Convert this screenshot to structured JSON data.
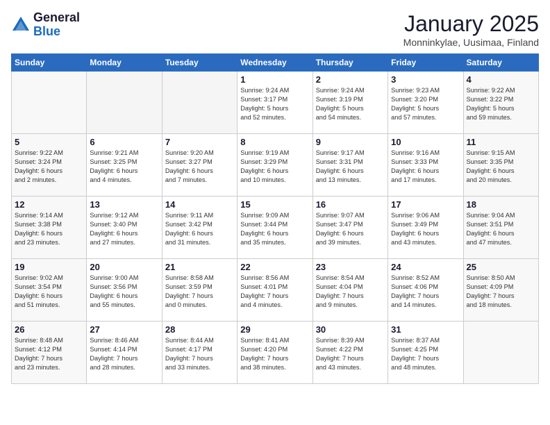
{
  "header": {
    "logo_general": "General",
    "logo_blue": "Blue",
    "month_year": "January 2025",
    "location": "Monninkylae, Uusimaa, Finland"
  },
  "days_of_week": [
    "Sunday",
    "Monday",
    "Tuesday",
    "Wednesday",
    "Thursday",
    "Friday",
    "Saturday"
  ],
  "weeks": [
    [
      {
        "day": "",
        "info": ""
      },
      {
        "day": "",
        "info": ""
      },
      {
        "day": "",
        "info": ""
      },
      {
        "day": "1",
        "info": "Sunrise: 9:24 AM\nSunset: 3:17 PM\nDaylight: 5 hours\nand 52 minutes."
      },
      {
        "day": "2",
        "info": "Sunrise: 9:24 AM\nSunset: 3:19 PM\nDaylight: 5 hours\nand 54 minutes."
      },
      {
        "day": "3",
        "info": "Sunrise: 9:23 AM\nSunset: 3:20 PM\nDaylight: 5 hours\nand 57 minutes."
      },
      {
        "day": "4",
        "info": "Sunrise: 9:22 AM\nSunset: 3:22 PM\nDaylight: 5 hours\nand 59 minutes."
      }
    ],
    [
      {
        "day": "5",
        "info": "Sunrise: 9:22 AM\nSunset: 3:24 PM\nDaylight: 6 hours\nand 2 minutes."
      },
      {
        "day": "6",
        "info": "Sunrise: 9:21 AM\nSunset: 3:25 PM\nDaylight: 6 hours\nand 4 minutes."
      },
      {
        "day": "7",
        "info": "Sunrise: 9:20 AM\nSunset: 3:27 PM\nDaylight: 6 hours\nand 7 minutes."
      },
      {
        "day": "8",
        "info": "Sunrise: 9:19 AM\nSunset: 3:29 PM\nDaylight: 6 hours\nand 10 minutes."
      },
      {
        "day": "9",
        "info": "Sunrise: 9:17 AM\nSunset: 3:31 PM\nDaylight: 6 hours\nand 13 minutes."
      },
      {
        "day": "10",
        "info": "Sunrise: 9:16 AM\nSunset: 3:33 PM\nDaylight: 6 hours\nand 17 minutes."
      },
      {
        "day": "11",
        "info": "Sunrise: 9:15 AM\nSunset: 3:35 PM\nDaylight: 6 hours\nand 20 minutes."
      }
    ],
    [
      {
        "day": "12",
        "info": "Sunrise: 9:14 AM\nSunset: 3:38 PM\nDaylight: 6 hours\nand 23 minutes."
      },
      {
        "day": "13",
        "info": "Sunrise: 9:12 AM\nSunset: 3:40 PM\nDaylight: 6 hours\nand 27 minutes."
      },
      {
        "day": "14",
        "info": "Sunrise: 9:11 AM\nSunset: 3:42 PM\nDaylight: 6 hours\nand 31 minutes."
      },
      {
        "day": "15",
        "info": "Sunrise: 9:09 AM\nSunset: 3:44 PM\nDaylight: 6 hours\nand 35 minutes."
      },
      {
        "day": "16",
        "info": "Sunrise: 9:07 AM\nSunset: 3:47 PM\nDaylight: 6 hours\nand 39 minutes."
      },
      {
        "day": "17",
        "info": "Sunrise: 9:06 AM\nSunset: 3:49 PM\nDaylight: 6 hours\nand 43 minutes."
      },
      {
        "day": "18",
        "info": "Sunrise: 9:04 AM\nSunset: 3:51 PM\nDaylight: 6 hours\nand 47 minutes."
      }
    ],
    [
      {
        "day": "19",
        "info": "Sunrise: 9:02 AM\nSunset: 3:54 PM\nDaylight: 6 hours\nand 51 minutes."
      },
      {
        "day": "20",
        "info": "Sunrise: 9:00 AM\nSunset: 3:56 PM\nDaylight: 6 hours\nand 55 minutes."
      },
      {
        "day": "21",
        "info": "Sunrise: 8:58 AM\nSunset: 3:59 PM\nDaylight: 7 hours\nand 0 minutes."
      },
      {
        "day": "22",
        "info": "Sunrise: 8:56 AM\nSunset: 4:01 PM\nDaylight: 7 hours\nand 4 minutes."
      },
      {
        "day": "23",
        "info": "Sunrise: 8:54 AM\nSunset: 4:04 PM\nDaylight: 7 hours\nand 9 minutes."
      },
      {
        "day": "24",
        "info": "Sunrise: 8:52 AM\nSunset: 4:06 PM\nDaylight: 7 hours\nand 14 minutes."
      },
      {
        "day": "25",
        "info": "Sunrise: 8:50 AM\nSunset: 4:09 PM\nDaylight: 7 hours\nand 18 minutes."
      }
    ],
    [
      {
        "day": "26",
        "info": "Sunrise: 8:48 AM\nSunset: 4:12 PM\nDaylight: 7 hours\nand 23 minutes."
      },
      {
        "day": "27",
        "info": "Sunrise: 8:46 AM\nSunset: 4:14 PM\nDaylight: 7 hours\nand 28 minutes."
      },
      {
        "day": "28",
        "info": "Sunrise: 8:44 AM\nSunset: 4:17 PM\nDaylight: 7 hours\nand 33 minutes."
      },
      {
        "day": "29",
        "info": "Sunrise: 8:41 AM\nSunset: 4:20 PM\nDaylight: 7 hours\nand 38 minutes."
      },
      {
        "day": "30",
        "info": "Sunrise: 8:39 AM\nSunset: 4:22 PM\nDaylight: 7 hours\nand 43 minutes."
      },
      {
        "day": "31",
        "info": "Sunrise: 8:37 AM\nSunset: 4:25 PM\nDaylight: 7 hours\nand 48 minutes."
      },
      {
        "day": "",
        "info": ""
      }
    ]
  ]
}
